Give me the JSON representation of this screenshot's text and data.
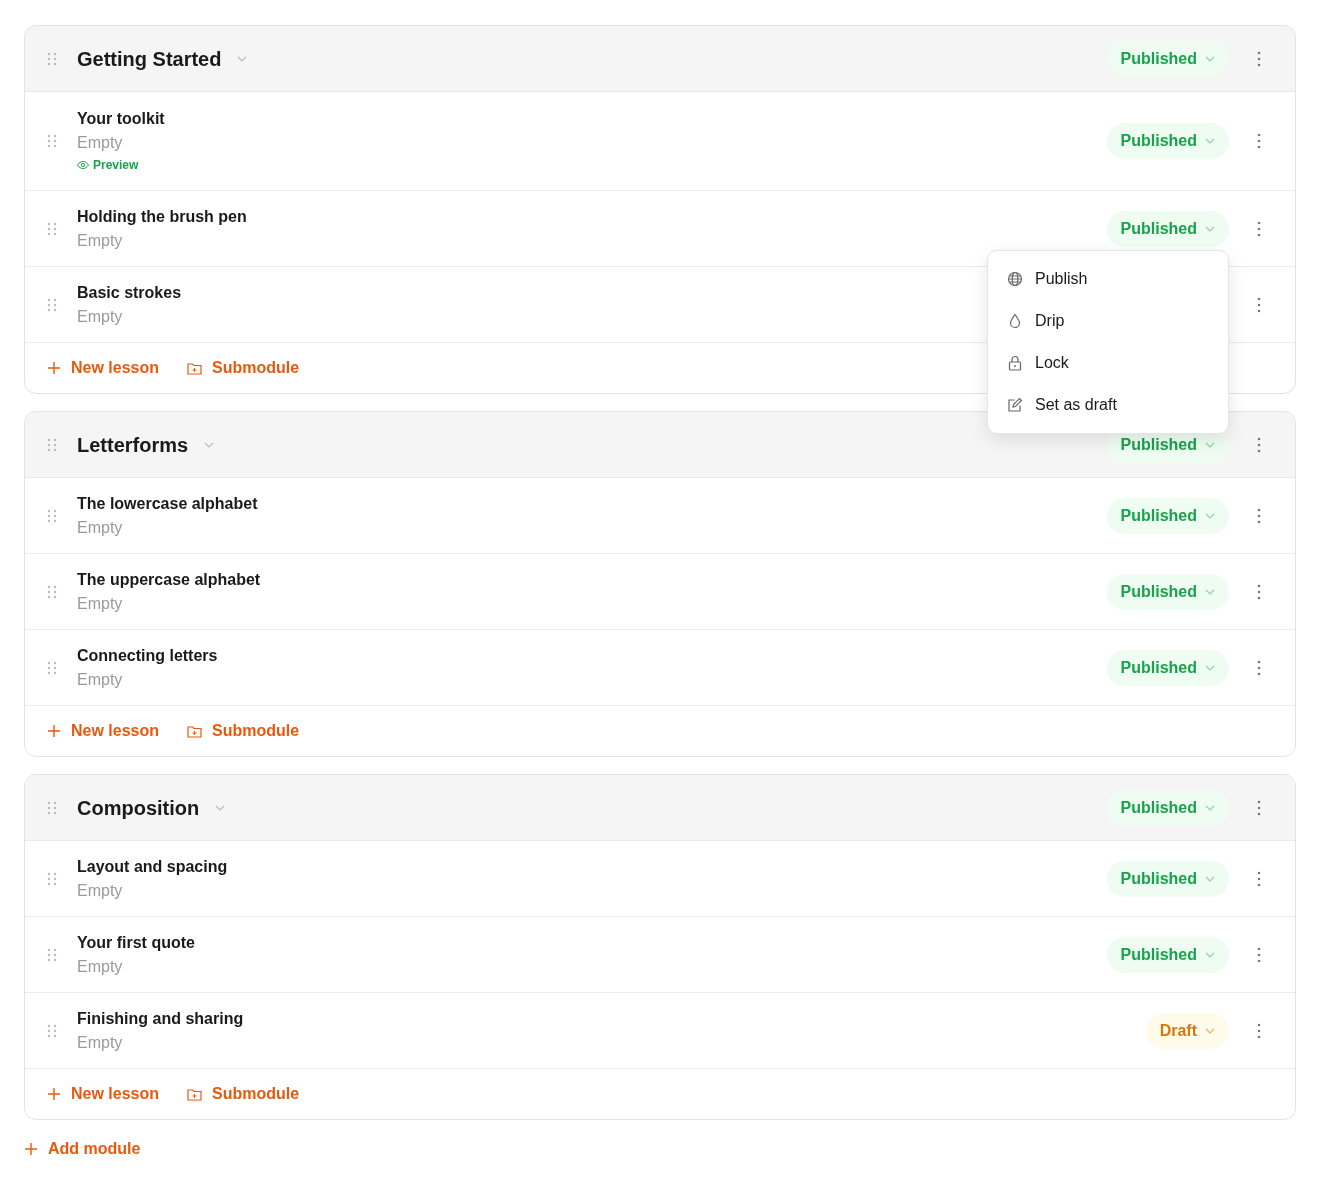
{
  "modules": [
    {
      "title": "Getting Started",
      "status": {
        "label": "Published",
        "kind": "published"
      },
      "lessons": [
        {
          "title": "Your toolkit",
          "subtitle": "Empty",
          "preview": "Preview",
          "status": {
            "label": "Published",
            "kind": "published"
          }
        },
        {
          "title": "Holding the brush pen",
          "subtitle": "Empty",
          "status": {
            "label": "Published",
            "kind": "published"
          },
          "status_menu": {
            "items": [
              {
                "label": "Publish",
                "kind": "globe"
              },
              {
                "label": "Drip",
                "kind": "drop"
              },
              {
                "label": "Lock",
                "kind": "lock"
              },
              {
                "label": "Set as draft",
                "kind": "edit"
              }
            ]
          }
        },
        {
          "title": "Basic strokes",
          "subtitle": "Empty"
        }
      ],
      "actions": [
        {
          "label": "New lesson",
          "kind": "add"
        },
        {
          "label": "Submodule",
          "kind": "folder"
        }
      ]
    },
    {
      "title": "Letterforms",
      "status": {
        "label": "Published",
        "kind": "published"
      },
      "lessons": [
        {
          "title": "The lowercase alphabet",
          "subtitle": "Empty",
          "status": {
            "label": "Published",
            "kind": "published"
          }
        },
        {
          "title": "The uppercase alphabet",
          "subtitle": "Empty",
          "status": {
            "label": "Published",
            "kind": "published"
          }
        },
        {
          "title": "Connecting letters",
          "subtitle": "Empty",
          "status": {
            "label": "Published",
            "kind": "published"
          }
        }
      ],
      "actions": [
        {
          "label": "New lesson",
          "kind": "add"
        },
        {
          "label": "Submodule",
          "kind": "folder"
        }
      ]
    },
    {
      "title": "Composition",
      "status": {
        "label": "Published",
        "kind": "published"
      },
      "lessons": [
        {
          "title": "Layout and spacing",
          "subtitle": "Empty",
          "status": {
            "label": "Published",
            "kind": "published"
          }
        },
        {
          "title": "Your first quote",
          "subtitle": "Empty",
          "status": {
            "label": "Published",
            "kind": "published"
          }
        },
        {
          "title": "Finishing and sharing",
          "subtitle": "Empty",
          "status": {
            "label": "Draft",
            "kind": "draft"
          }
        }
      ],
      "actions": [
        {
          "label": "New lesson",
          "kind": "add"
        },
        {
          "label": "Submodule",
          "kind": "folder"
        }
      ]
    }
  ],
  "add_module": "Add module"
}
